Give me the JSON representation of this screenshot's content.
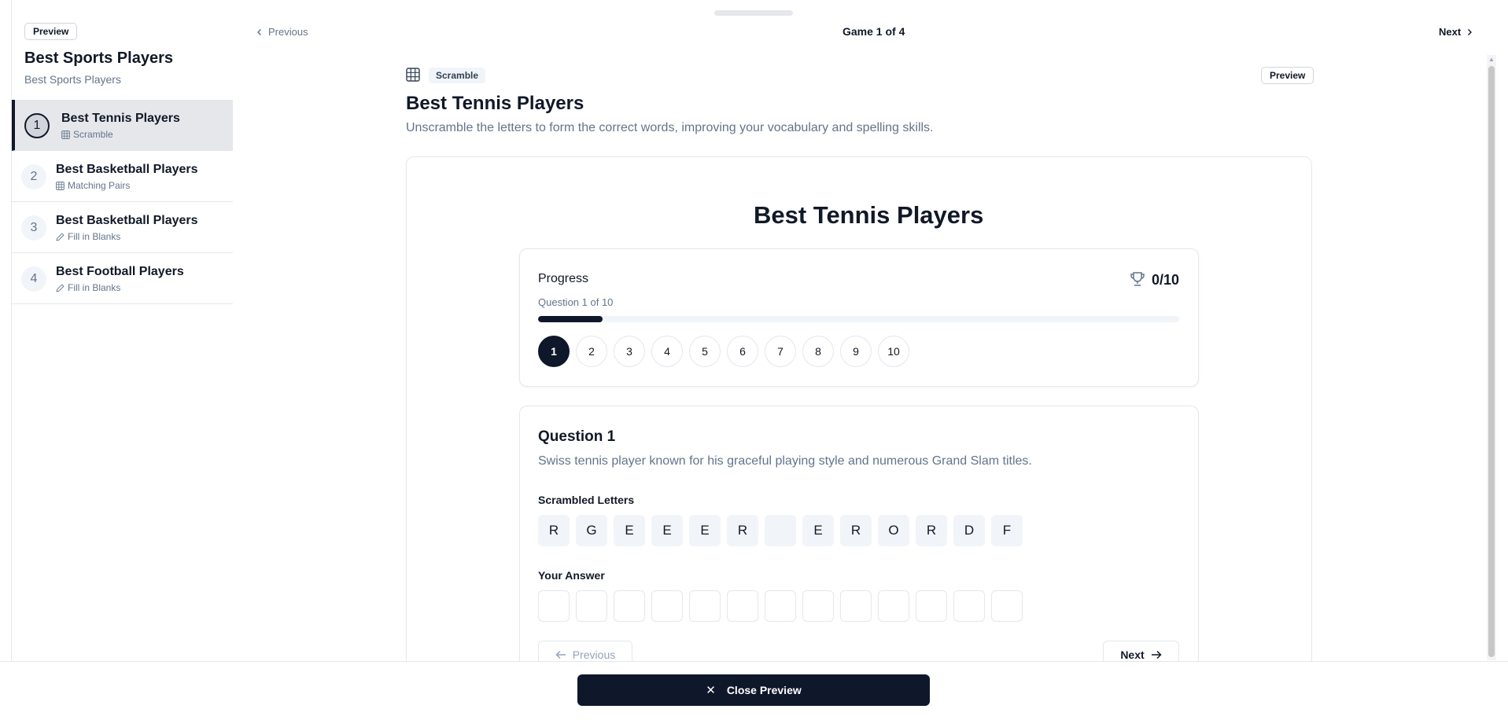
{
  "sidebar": {
    "preview_chip": "Preview",
    "course_title": "Best Sports Players",
    "course_subtitle": "Best Sports Players",
    "games": [
      {
        "num": "1",
        "name": "Best Tennis Players",
        "type": "Scramble",
        "icon": "grid-icon",
        "active": true
      },
      {
        "num": "2",
        "name": "Best Basketball Players",
        "type": "Matching Pairs",
        "icon": "grid-icon",
        "active": false
      },
      {
        "num": "3",
        "name": "Best Basketball Players",
        "type": "Fill in Blanks",
        "icon": "pencil-icon",
        "active": false
      },
      {
        "num": "4",
        "name": "Best Football Players",
        "type": "Fill in Blanks",
        "icon": "pencil-icon",
        "active": false
      }
    ]
  },
  "topnav": {
    "prev_label": "Previous",
    "title": "Game 1 of 4",
    "next_label": "Next"
  },
  "main": {
    "type_badge": "Scramble",
    "preview_button": "Preview",
    "heading": "Best Tennis Players",
    "description": "Unscramble the letters to form the correct words, improving your vocabulary and spelling skills.",
    "card_title": "Best Tennis Players"
  },
  "progress": {
    "label": "Progress",
    "score": "0/10",
    "question_of": "Question 1 of 10",
    "fraction": 0.1,
    "questions": [
      "1",
      "2",
      "3",
      "4",
      "5",
      "6",
      "7",
      "8",
      "9",
      "10"
    ],
    "current": 0
  },
  "question": {
    "title": "Question 1",
    "text": "Swiss tennis player known for his graceful playing style and numerous Grand Slam titles.",
    "scrambled_label": "Scrambled Letters",
    "letters": [
      "R",
      "G",
      "E",
      "E",
      "E",
      "R",
      " ",
      "E",
      "R",
      "O",
      "R",
      "D",
      "F"
    ],
    "answer_label": "Your Answer",
    "answer_slots": 13,
    "prev_label": "Previous",
    "next_label": "Next"
  },
  "footer": {
    "close_label": "Close Preview"
  },
  "colors": {
    "accent": "#0f172a",
    "muted_text": "#64748b",
    "active_item_bg": "#e5e7eb"
  }
}
